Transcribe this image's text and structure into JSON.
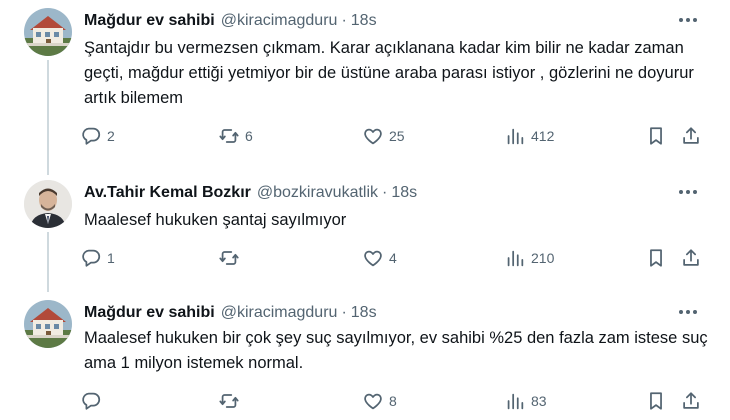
{
  "tweets": [
    {
      "name": "Mağdur ev sahibi",
      "handle": "@kiracimagduru",
      "separator": "·",
      "time": "18s",
      "text": "Şantajdır bu vermezsen çıkmam. Karar açıklanana kadar kim bilir ne kadar zaman geçti, mağdur ettiği yetmiyor bir de üstüne araba parası istiyor , gözlerini ne doyurur artık bilemem",
      "replies": "2",
      "retweets": "6",
      "likes": "25",
      "views": "412"
    },
    {
      "name": "Av.Tahir Kemal Bozkır",
      "handle": "@bozkiravukatlik",
      "separator": "·",
      "time": "18s",
      "text": "Maalesef hukuken şantaj sayılmıyor",
      "replies": "1",
      "retweets": "",
      "likes": "4",
      "views": "210"
    },
    {
      "name": "Mağdur ev sahibi",
      "handle": "@kiracimagduru",
      "separator": "·",
      "time": "18s",
      "text": "Maalesef hukuken bir çok şey suç sayılmıyor, ev sahibi %25 den fazla zam istese suç ama 1 milyon istemek normal.",
      "replies": "",
      "retweets": "",
      "likes": "8",
      "views": "83"
    }
  ],
  "icons": {
    "reply": "reply-icon",
    "retweet": "retweet-icon",
    "like": "heart-icon",
    "views": "views-icon",
    "bookmark": "bookmark-icon",
    "share": "share-icon",
    "more": "more-icon"
  },
  "colors": {
    "text": "#0f1419",
    "secondary": "#536471",
    "thread_line": "#cfd9de"
  }
}
